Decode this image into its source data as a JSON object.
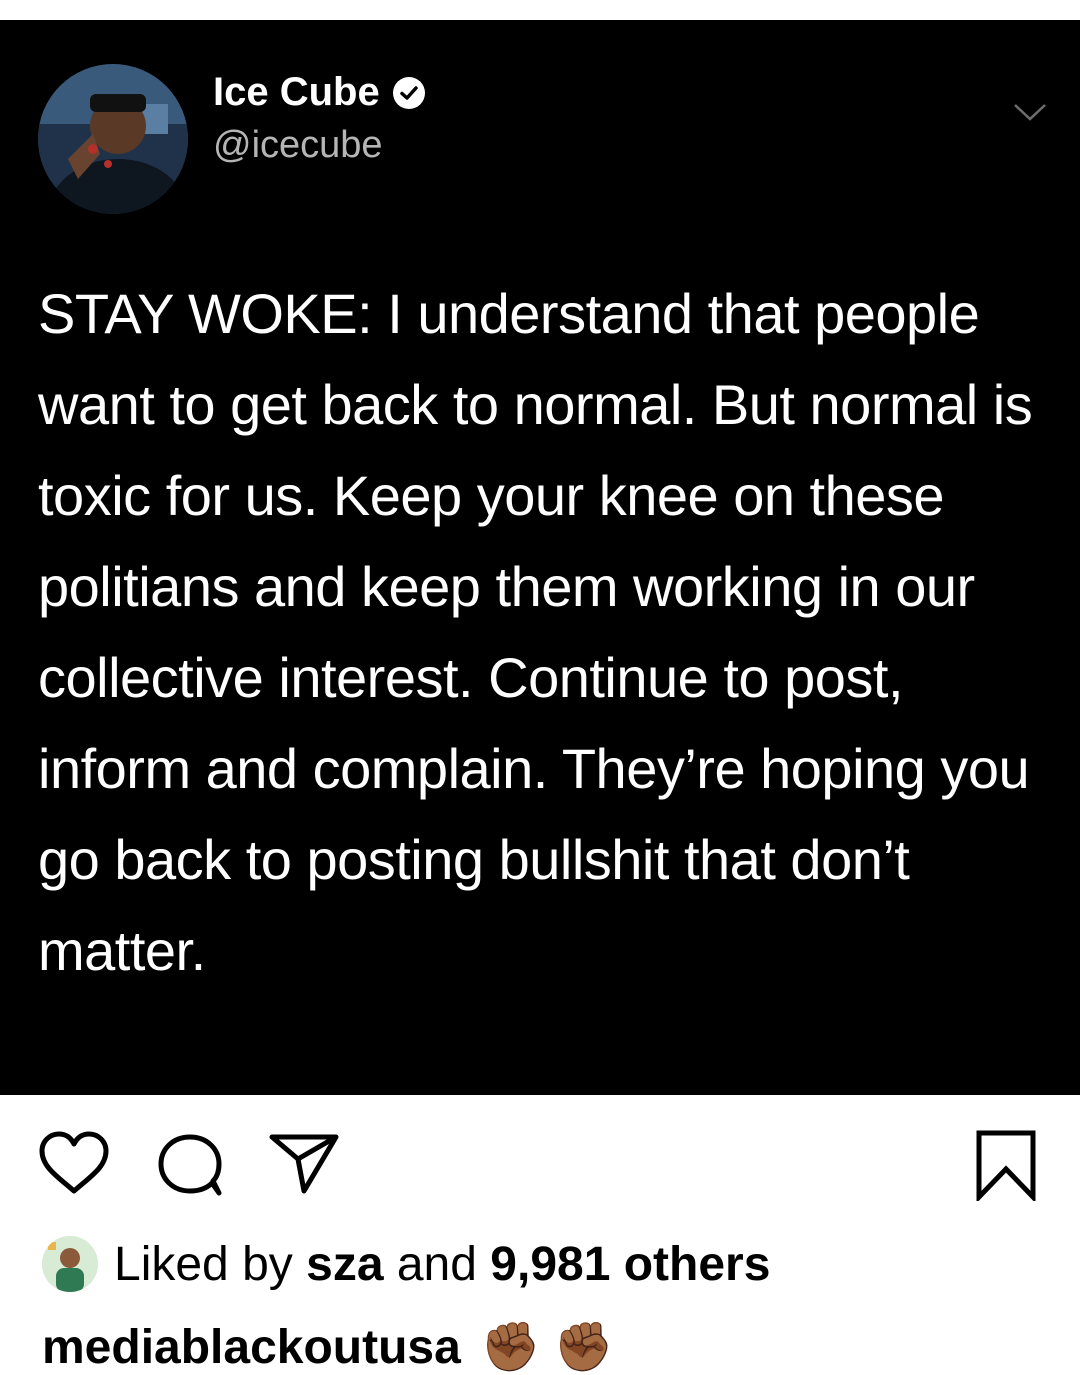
{
  "account": {
    "display_name": "Ice Cube",
    "handle": "@icecube"
  },
  "tweet": {
    "text": "STAY WOKE: I understand that people want to get back to normal. But normal is toxic for us. Keep your knee on these politians and keep them working in our collective interest. Continue to post, inform and complain. They’re hoping you go back to posting bullshit that don’t matter."
  },
  "icons": {
    "verified": "verified-badge-icon",
    "menu": "chevron-down-icon",
    "like": "heart-icon",
    "comment": "comment-icon",
    "share": "paper-plane-icon",
    "save": "bookmark-icon"
  },
  "likes": {
    "prefix": "Liked by ",
    "first_liker": "sza",
    "middle": " and ",
    "count": "9,981 others"
  },
  "caption": {
    "username": "mediablackoutusa",
    "emoji": "✊🏾 ✊🏾"
  },
  "colors": {
    "tweet_bg": "#000000",
    "text_primary": "#ffffff",
    "text_secondary": "#b5b5b5"
  }
}
